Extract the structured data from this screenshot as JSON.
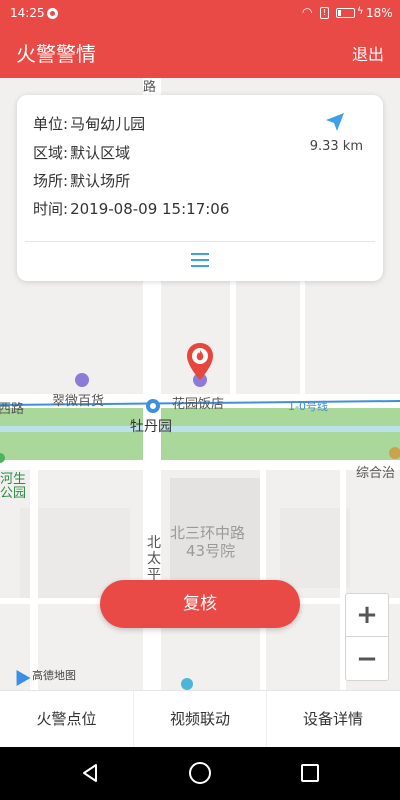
{
  "status_bar": {
    "time": "14:25",
    "battery_percent": "18%",
    "battery_level": 0.18
  },
  "app_bar": {
    "title": "火警警情",
    "logout_label": "退出"
  },
  "info_card": {
    "unit_label": "单位:",
    "unit_value": "马甸幼儿园",
    "area_label": "区域:",
    "area_value": "默认区域",
    "place_label": "场所:",
    "place_value": "默认场所",
    "time_label": "时间:",
    "time_value": "2019-08-09 15:17:06",
    "distance": "9.33 km",
    "nav_icon": "navigation-arrow-icon",
    "menu_icon": "menu-icon"
  },
  "map": {
    "labels": {
      "road_top": "路",
      "store": "翠微百货",
      "restaurant": "花园饭店",
      "station": "牡丹园",
      "road_west": "西路",
      "metro_line": "1-0号线",
      "park": "河生\n公园",
      "park_line1": "河生",
      "park_line2": "公园",
      "complex": "综合治",
      "block_line1": "北三环中路",
      "block_line2": "43号院",
      "road_vertical_1": "北",
      "road_vertical_2": "太",
      "road_vertical_3": "平",
      "map_provider": "高德地图"
    },
    "colors": {
      "green_belt": "#a9d89a",
      "road": "#ffffff",
      "metro": "#3f8fdc",
      "marker": "#e8453c"
    }
  },
  "review_button": {
    "label": "复核"
  },
  "zoom": {
    "in_label": "+",
    "out_label": "−"
  },
  "bottom_tabs": [
    {
      "label": "火警点位"
    },
    {
      "label": "视频联动"
    },
    {
      "label": "设备详情"
    }
  ]
}
